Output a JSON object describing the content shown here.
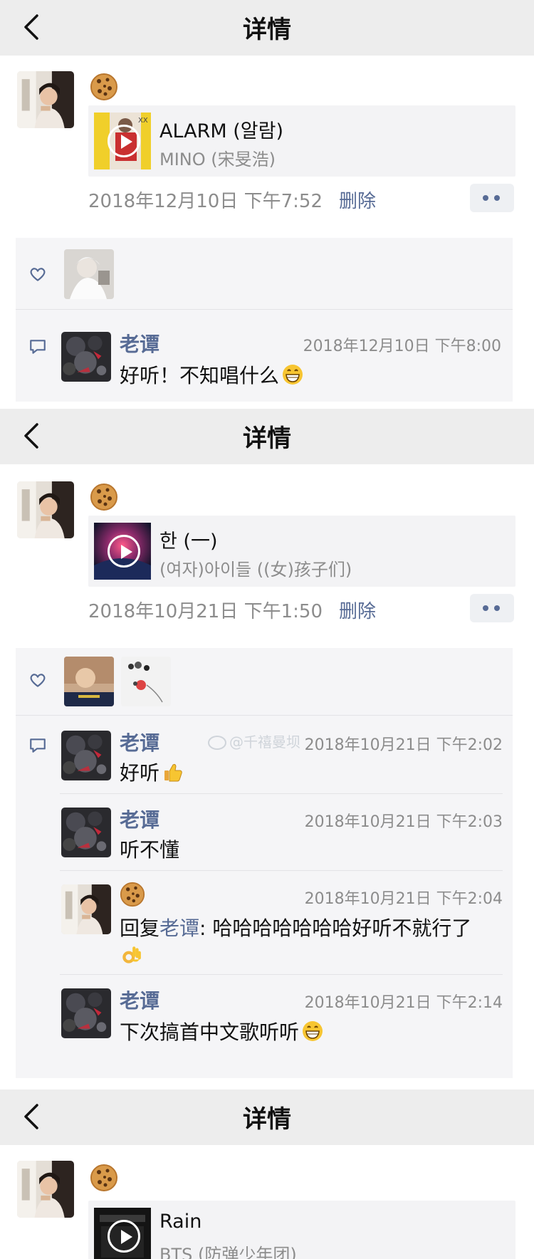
{
  "screen1": {
    "title": "详情",
    "post": {
      "song": "ALARM (알람)",
      "artist": "MINO (宋旻浩)",
      "time": "2018年12月10日 下午7:52",
      "delete": "删除"
    },
    "comment": {
      "name": "老谭",
      "time": "2018年12月10日 下午8:00",
      "text": "好听！不知唱什么"
    }
  },
  "screen2": {
    "title": "详情",
    "post": {
      "song": "한 (一)",
      "artist": "(여자)아이들 ((女)孩子们)",
      "time": "2018年10月21日 下午1:50",
      "delete": "删除"
    },
    "comments": [
      {
        "name": "老谭",
        "time": "2018年10月21日 下午2:02",
        "text": "好听"
      },
      {
        "name": "老谭",
        "time": "2018年10月21日 下午2:03",
        "text": "听不懂"
      },
      {
        "time": "2018年10月21日 下午2:04",
        "reply_prefix": "回复",
        "reply_to": "老谭",
        "text": ": 哈哈哈哈哈哈哈好听不就行了"
      },
      {
        "name": "老谭",
        "time": "2018年10月21日 下午2:14",
        "text": "下次搞首中文歌听听"
      }
    ],
    "watermark": "@千禧曼坝"
  },
  "screen3": {
    "title": "详情",
    "post": {
      "song": "Rain",
      "artist": "BTS (防弹少年团)"
    }
  },
  "colors": {
    "nav_bg": "#ededed",
    "link_blue": "#576b95",
    "gray_text": "#8c8c8c",
    "panel_bg": "#f5f5f7"
  },
  "icons": [
    "back-chevron-icon",
    "heart-icon",
    "comment-icon",
    "cookie-emoji-icon",
    "play-icon",
    "grin-emoji-icon",
    "thumbs-up-emoji-icon",
    "ok-hand-emoji-icon",
    "weibo-icon"
  ]
}
